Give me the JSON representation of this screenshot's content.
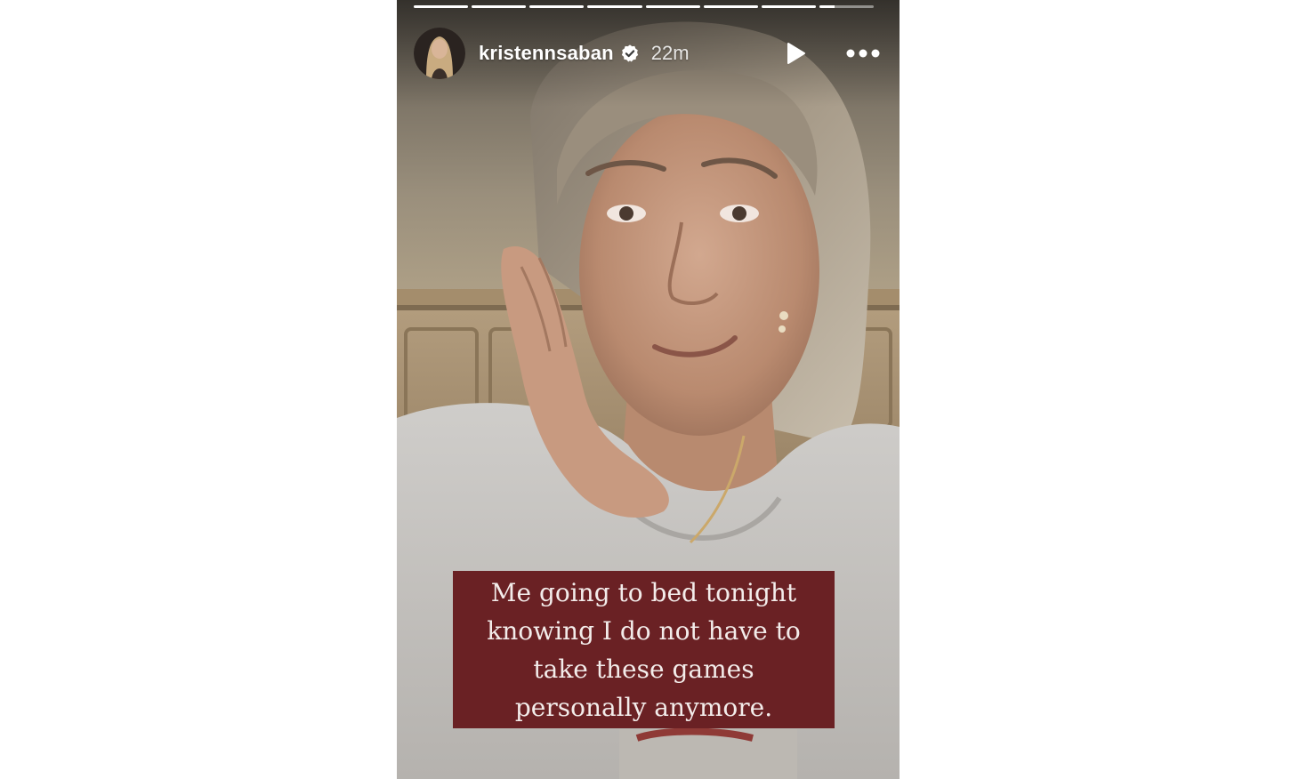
{
  "story": {
    "username": "kristennsaban",
    "verified": true,
    "timestamp": "22m",
    "progress": {
      "segments_total": 8,
      "segments_completed": 7,
      "current_segment_fraction": 0.28
    },
    "caption": "Me going to bed tonight\nknowing I do not have to\ntake these games\npersonally anymore.",
    "colors": {
      "caption_background": "#6a2124",
      "caption_text": "#f3ecea",
      "page_background": "#ffffff"
    },
    "icons": {
      "play": "play-icon",
      "more": "more-options-icon",
      "verified": "verified-badge-icon"
    }
  }
}
